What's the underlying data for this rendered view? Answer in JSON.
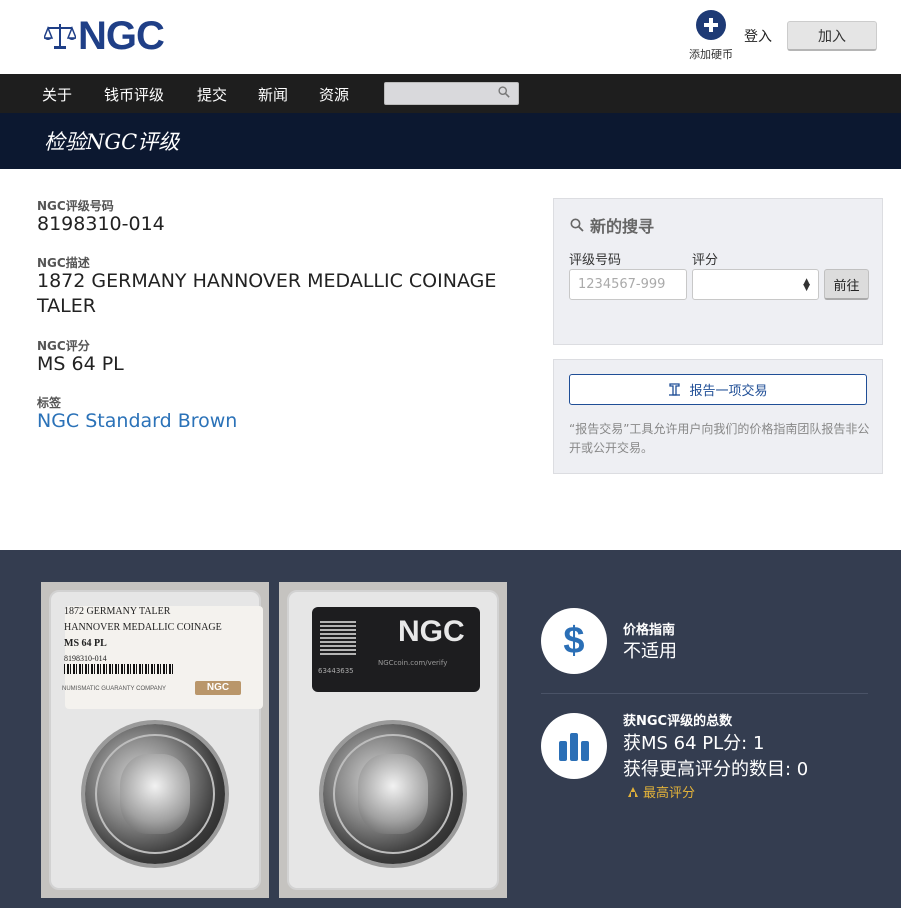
{
  "header": {
    "logo_text": "NGC",
    "add_coin_label": "添加硬币",
    "login_label": "登入",
    "join_label": "加入"
  },
  "nav": {
    "items": [
      {
        "label": "关于"
      },
      {
        "label": "钱币评级"
      },
      {
        "label": "提交"
      },
      {
        "label": "新闻"
      },
      {
        "label": "资源"
      }
    ],
    "search_placeholder": ""
  },
  "banner": {
    "title": "检验NGC评级"
  },
  "details": {
    "cert_label": "NGC评级号码",
    "cert_value": "8198310-014",
    "desc_label": "NGC描述",
    "desc_value": "1872 GERMANY HANNOVER MEDALLIC COINAGE TALER",
    "grade_label": "NGC评分",
    "grade_value": "MS 64 PL",
    "label_label": "标签",
    "label_value": "NGC Standard Brown"
  },
  "new_search": {
    "title": "新的搜寻",
    "cert_label": "评级号码",
    "cert_placeholder": "1234567-999",
    "grade_label": "评分",
    "grade_value": "",
    "go_label": "前往"
  },
  "report": {
    "button_label": "报告一项交易",
    "description": "“报告交易”工具允许用户向我们的价格指南团队报告非公开或公开交易。"
  },
  "slab": {
    "label_line1": "1872 GERMANY TALER",
    "label_line2": "HANNOVER MEDALLIC COINAGE",
    "label_line3": "MS 64 PL",
    "label_line4": "8198310-014",
    "label_footer": "NUMISMATIC GUARANTY COMPANY",
    "label_brand": "NGC",
    "reverse_brand": "NGC",
    "reverse_url": "NGCcoin.com/verify",
    "reverse_number": "63443635"
  },
  "stats": {
    "price_guide_title": "价格指南",
    "price_guide_value": "不适用",
    "census_title": "获NGC评级的总数",
    "census_at_grade": "获MS 64 PL分: 1",
    "census_higher": "获得更高评分的数目: 0",
    "top_grade_label": "最高评分"
  },
  "colors": {
    "brand_blue": "#1f3f87",
    "nav_bg": "#1e1e1e",
    "banner_bg": "#0c1830",
    "bottom_bg": "#343d50",
    "link": "#2b72b8",
    "icon_blue": "#2b6fb6",
    "top_grade": "#e2b23a"
  }
}
